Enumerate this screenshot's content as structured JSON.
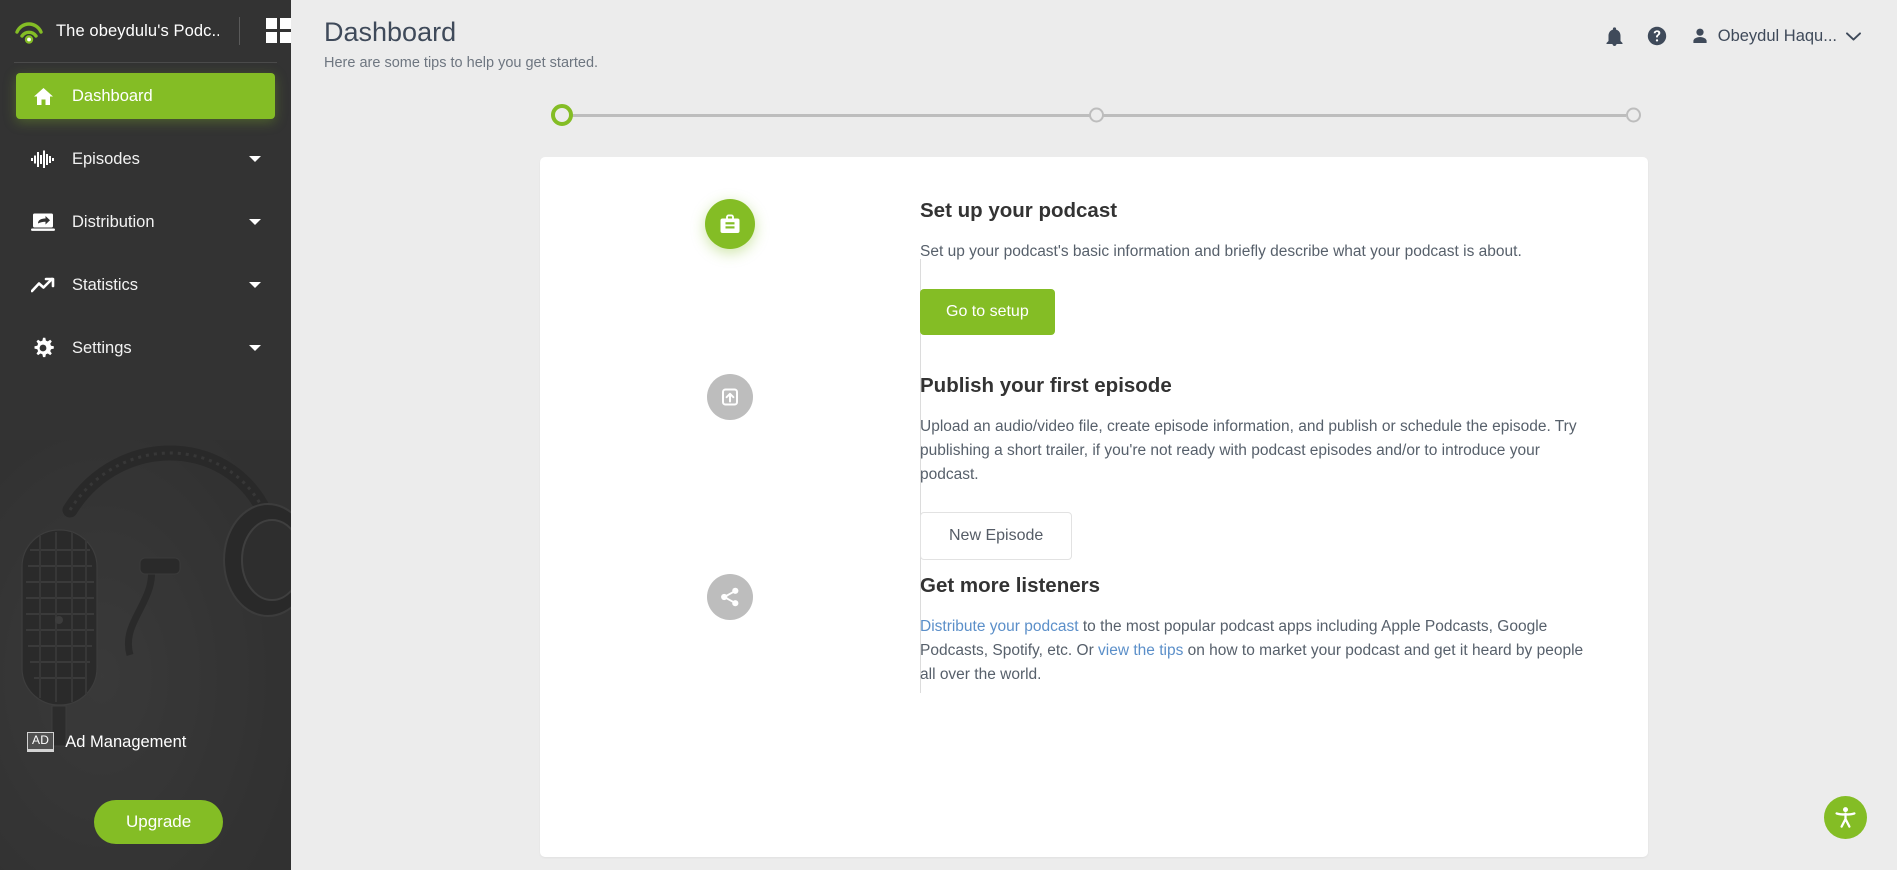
{
  "sidebar": {
    "brand_name": "The obeydulu's Podc...",
    "logo_icon": "podcast-wifi-icon",
    "grid_icon": "grid-apps-icon",
    "items": [
      {
        "label": "Dashboard",
        "icon": "home-icon",
        "active": true,
        "caret": false
      },
      {
        "label": "Episodes",
        "icon": "waveform-icon",
        "active": false,
        "caret": true
      },
      {
        "label": "Distribution",
        "icon": "distribute-icon",
        "active": false,
        "caret": true
      },
      {
        "label": "Statistics",
        "icon": "trending-up-icon",
        "active": false,
        "caret": true
      },
      {
        "label": "Settings",
        "icon": "gear-icon",
        "active": false,
        "caret": true
      }
    ],
    "ad": {
      "badge": "AD",
      "title": "Ad Management",
      "upgrade_label": "Upgrade"
    }
  },
  "header": {
    "title": "Dashboard",
    "subtitle": "Here are some tips to help you get started.",
    "notification_icon": "bell-icon",
    "help_icon": "question-circle-icon",
    "user_icon": "person-icon",
    "user_name": "Obeydul Haqu...",
    "chevron_icon": "chevron-down-icon"
  },
  "stepper": {
    "steps": [
      {
        "state": "active"
      },
      {
        "state": "todo"
      },
      {
        "state": "todo"
      }
    ]
  },
  "steps": [
    {
      "icon": "briefcase-icon",
      "title": "Set up your podcast",
      "text": "Set up your podcast's basic information and briefly describe what your podcast is about.",
      "button": "Go to setup"
    },
    {
      "icon": "upload-publish-icon",
      "title": "Publish your first episode",
      "text": "Upload an audio/video file, create episode information, and publish or schedule the episode. Try publishing a short trailer, if you're not ready with podcast episodes and/or to introduce your podcast.",
      "button": "New Episode"
    },
    {
      "icon": "share-icon",
      "title": "Get more listeners",
      "link1": "Distribute your podcast",
      "mid": " to the most popular podcast apps including Apple Podcasts, Google Podcasts, Spotify, etc. Or ",
      "link2": "view the tips",
      "tail": " on how to market your podcast and get it heard by people all over the world."
    }
  ],
  "accessibility": {
    "icon": "accessibility-icon",
    "label": "Accessibility"
  },
  "colors": {
    "green": "#84bd25",
    "sidebar": "#333333",
    "page_bg": "#ececec",
    "link": "#5b8fc9",
    "title": "#3f4a5a"
  }
}
